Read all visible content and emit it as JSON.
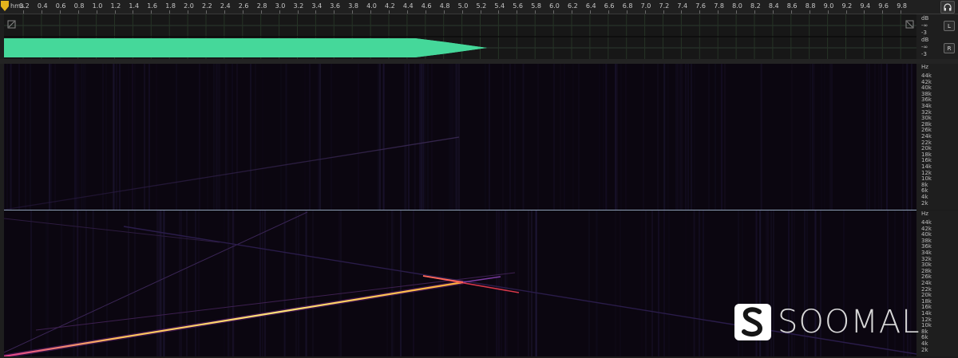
{
  "ruler": {
    "unit": "hms",
    "ticks": [
      "0.2",
      "0.4",
      "0.6",
      "0.8",
      "1.0",
      "1.2",
      "1.4",
      "1.6",
      "1.8",
      "2.0",
      "2.2",
      "2.4",
      "2.6",
      "2.8",
      "3.0",
      "3.2",
      "3.4",
      "3.6",
      "3.8",
      "4.0",
      "4.2",
      "4.4",
      "4.6",
      "4.8",
      "5.0",
      "5.2",
      "5.4",
      "5.6",
      "5.8",
      "6.0",
      "6.2",
      "6.4",
      "6.6",
      "6.8",
      "7.0",
      "7.2",
      "7.4",
      "7.6",
      "7.8",
      "8.0",
      "8.2",
      "8.4",
      "8.6",
      "8.8",
      "9.0",
      "9.2",
      "9.4",
      "9.6",
      "9.8"
    ]
  },
  "waveform": {
    "color": "#45d89a",
    "envelope_end_seconds": 5.3
  },
  "meter": {
    "db_top": "dB",
    "inf_top": "-∞",
    "m3_top": "-3",
    "db_bot": "dB",
    "inf_bot": "-∞",
    "m3_bot": "-3",
    "left_label": "L",
    "right_label": "R"
  },
  "frequency_axis": {
    "unit": "Hz",
    "labels": [
      "44k",
      "42k",
      "40k",
      "38k",
      "36k",
      "34k",
      "32k",
      "30k",
      "28k",
      "26k",
      "24k",
      "22k",
      "20k",
      "18k",
      "16k",
      "14k",
      "12k",
      "10k",
      "8k",
      "6k",
      "4k",
      "2k"
    ]
  },
  "watermark": {
    "text": "SOOMAL"
  },
  "icons": {
    "playhead": "playhead-marker-icon",
    "monitor": "headphone-icon"
  }
}
